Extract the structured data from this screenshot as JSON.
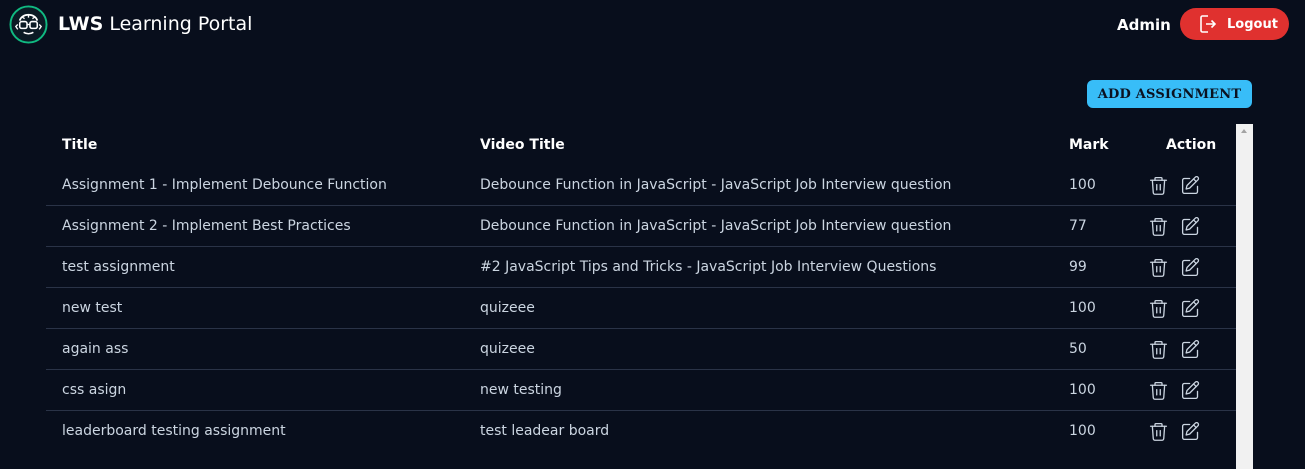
{
  "header": {
    "brand_bold": "LWS",
    "brand_rest": " Learning Portal",
    "user_label": "Admin",
    "logout_label": "Logout"
  },
  "toolbar": {
    "add_label": "ADD ASSIGNMENT"
  },
  "table": {
    "columns": [
      "Title",
      "Video Title",
      "Mark",
      "Action"
    ],
    "rows": [
      {
        "title": "Assignment 1 - Implement Debounce Function",
        "video": "Debounce Function in JavaScript - JavaScript Job Interview question",
        "mark": "100"
      },
      {
        "title": "Assignment 2 - Implement Best Practices",
        "video": "Debounce Function in JavaScript - JavaScript Job Interview question",
        "mark": "77"
      },
      {
        "title": "test assignment",
        "video": "#2 JavaScript Tips and Tricks - JavaScript Job Interview Questions",
        "mark": "99"
      },
      {
        "title": "new test",
        "video": "quizeee",
        "mark": "100"
      },
      {
        "title": "again ass",
        "video": "quizeee",
        "mark": "50"
      },
      {
        "title": "css asign",
        "video": "new testing",
        "mark": "100"
      },
      {
        "title": "leaderboard testing assignment",
        "video": "test leadear board",
        "mark": "100"
      }
    ]
  },
  "icons": {
    "logo": "learning-portal-logo",
    "logout": "logout-icon",
    "delete": "trash-icon",
    "edit": "edit-icon"
  },
  "colors": {
    "background": "#080e1c",
    "logout": "#e0312f",
    "add_button": "#38bdf8",
    "logo_ring": "#10b981"
  }
}
